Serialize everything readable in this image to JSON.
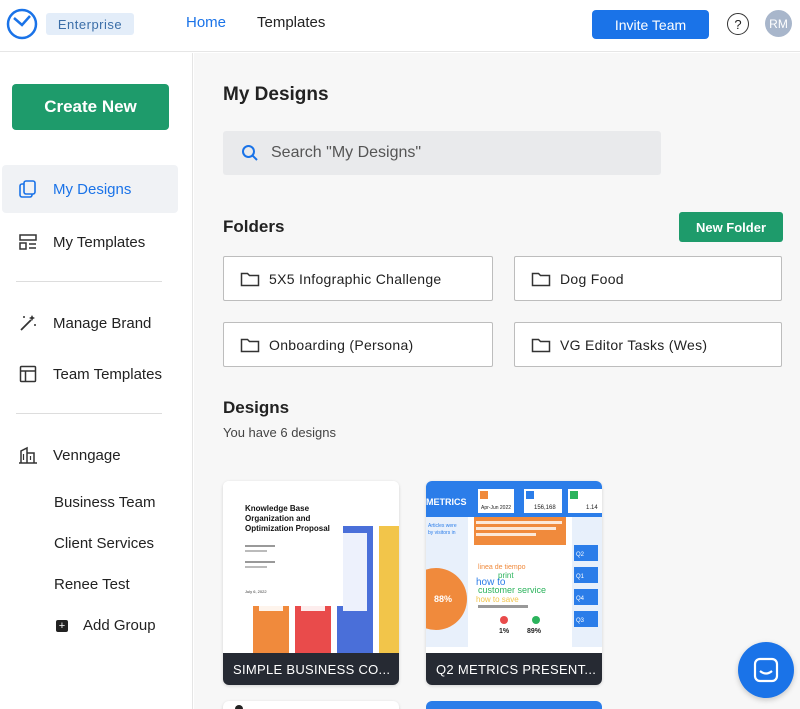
{
  "header": {
    "plan_badge": "Enterprise",
    "nav": [
      {
        "label": "Home"
      },
      {
        "label": "Templates"
      }
    ],
    "invite_label": "Invite Team",
    "help_label": "?",
    "avatar_initials": "RM"
  },
  "sidebar": {
    "create_label": "Create New",
    "items": [
      {
        "label": "My Designs",
        "icon": "designs-icon"
      },
      {
        "label": "My Templates",
        "icon": "templates-icon"
      },
      {
        "label": "Manage Brand",
        "icon": "magic-wand-icon"
      },
      {
        "label": "Team Templates",
        "icon": "table-icon"
      },
      {
        "label": "Venngage",
        "icon": "building-icon"
      }
    ],
    "groups": [
      {
        "label": "Business Team"
      },
      {
        "label": "Client Services"
      },
      {
        "label": "Renee Test"
      }
    ],
    "add_group_label": "Add Group"
  },
  "main": {
    "title": "My Designs",
    "search_placeholder": "Search \"My Designs\"",
    "folders_heading": "Folders",
    "new_folder_label": "New Folder",
    "folders": [
      {
        "name": "5X5 Infographic Challenge"
      },
      {
        "name": "Dog Food"
      },
      {
        "name": "Onboarding (Persona)"
      },
      {
        "name": "VG Editor Tasks (Wes)"
      }
    ],
    "designs_heading": "Designs",
    "designs_count_text": "You have 6 designs",
    "designs": [
      {
        "caption": "SIMPLE BUSINESS CO...",
        "thumb_title": "Knowledge Base Organization and Optimization Proposal",
        "thumb_date": "July 6, 2022"
      },
      {
        "caption": "Q2 METRICS PRESENT...",
        "thumb_header": "METRICS",
        "thumb_stats": [
          "Apr-Jun 2022",
          "156,168",
          "1.14"
        ],
        "thumb_percent_main": "88%",
        "thumb_percent_a": "1%",
        "thumb_percent_b": "89%",
        "thumb_quarters": [
          "Q2",
          "Q1",
          "Q4",
          "Q3"
        ],
        "thumb_words": [
          "linea de tiempo",
          "print",
          "how to",
          "customer service",
          "how to save"
        ]
      }
    ]
  },
  "colors": {
    "primary_blue": "#1a73e8",
    "create_green": "#1e9b6b",
    "caption_dark": "#262a33"
  }
}
